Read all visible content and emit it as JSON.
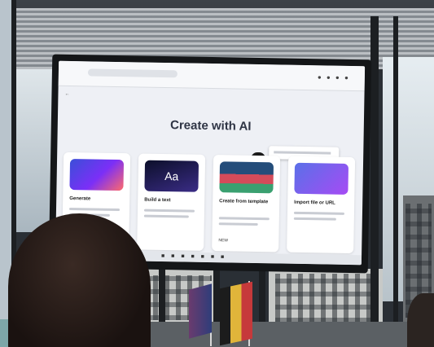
{
  "screen": {
    "headline": "Create with AI",
    "cards": [
      {
        "title": "Generate",
        "art_glyph": ""
      },
      {
        "title": "Build a text",
        "art_glyph": "Aa"
      },
      {
        "title": "Create from template",
        "art_glyph": "",
        "tag": "NEW"
      },
      {
        "title": "Import file or URL",
        "art_glyph": ""
      }
    ]
  }
}
